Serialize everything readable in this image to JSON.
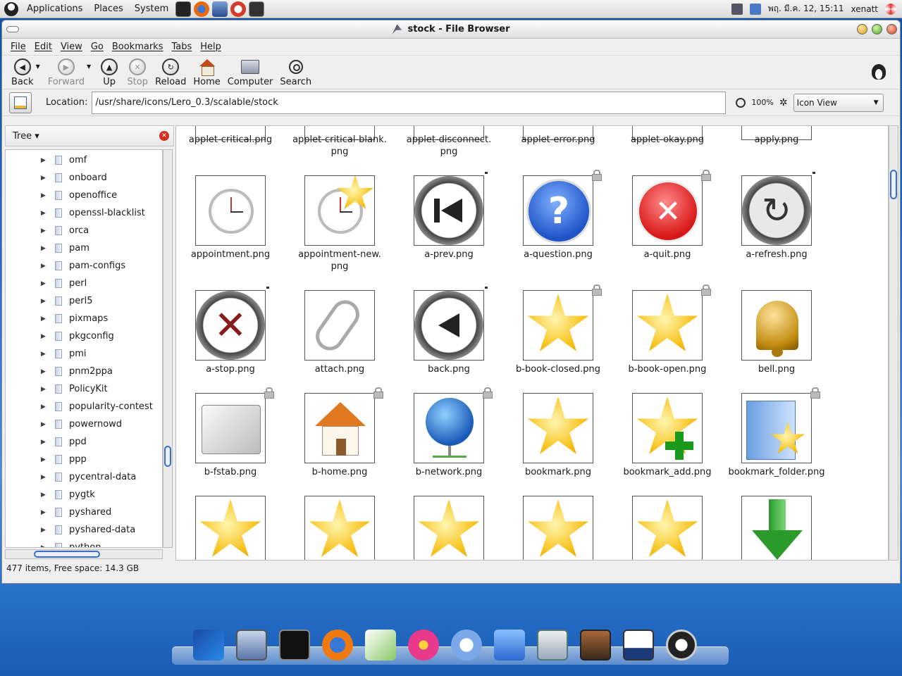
{
  "top_panel": {
    "menus": [
      "Applications",
      "Places",
      "System"
    ],
    "clock": "พฤ. มี.ค. 12, 15:11",
    "user": "xenatt"
  },
  "window": {
    "title": "stock - File Browser",
    "menubar": [
      "File",
      "Edit",
      "View",
      "Go",
      "Bookmarks",
      "Tabs",
      "Help"
    ],
    "toolbar": {
      "back": "Back",
      "forward": "Forward",
      "up": "Up",
      "stop": "Stop",
      "reload": "Reload",
      "home": "Home",
      "computer": "Computer",
      "search": "Search"
    },
    "location": {
      "label": "Location:",
      "path": "/usr/share/icons/Lero_0.3/scalable/stock",
      "zoom": "100%",
      "view_mode": "Icon View"
    }
  },
  "sidebar": {
    "mode": "Tree",
    "items": [
      "omf",
      "onboard",
      "openoffice",
      "openssl-blacklist",
      "orca",
      "pam",
      "pam-configs",
      "perl",
      "perl5",
      "pixmaps",
      "pkgconfig",
      "pmi",
      "pnm2ppa",
      "PolicyKit",
      "popularity-contest",
      "powernowd",
      "ppd",
      "ppp",
      "pycentral-data",
      "pygtk",
      "pyshared",
      "pyshared-data",
      "python"
    ]
  },
  "files": {
    "row0": [
      "applet-critical.png",
      "applet-critical-blank.\npng",
      "applet-disconnect.\npng",
      "applet-error.png",
      "applet-okay.png",
      "apply.png"
    ],
    "row1": [
      "appointment.png",
      "appointment-new.\npng",
      "a-prev.png",
      "a-question.png",
      "a-quit.png",
      "a-refresh.png"
    ],
    "row2": [
      "a-stop.png",
      "attach.png",
      "back.png",
      "b-book-closed.png",
      "b-book-open.png",
      "bell.png"
    ],
    "row3": [
      "b-fstab.png",
      "b-home.png",
      "b-network.png",
      "bookmark.png",
      "bookmark_add.png",
      "bookmark_folder.png"
    ]
  },
  "status": "477 items, Free space: 14.3 GB",
  "icons": {
    "toolbar": [
      "back-icon",
      "forward-icon",
      "up-icon",
      "stop-icon",
      "reload-icon",
      "home-icon",
      "computer-icon",
      "search-icon"
    ],
    "dock": [
      "windows-logo-icon",
      "system-monitor-icon",
      "terminal-icon",
      "firefox-icon",
      "paint-icon",
      "flower-icon",
      "music-icon",
      "file-manager-icon",
      "desktop-icon",
      "image-viewer-icon",
      "calendar-icon",
      "power-icon"
    ]
  }
}
